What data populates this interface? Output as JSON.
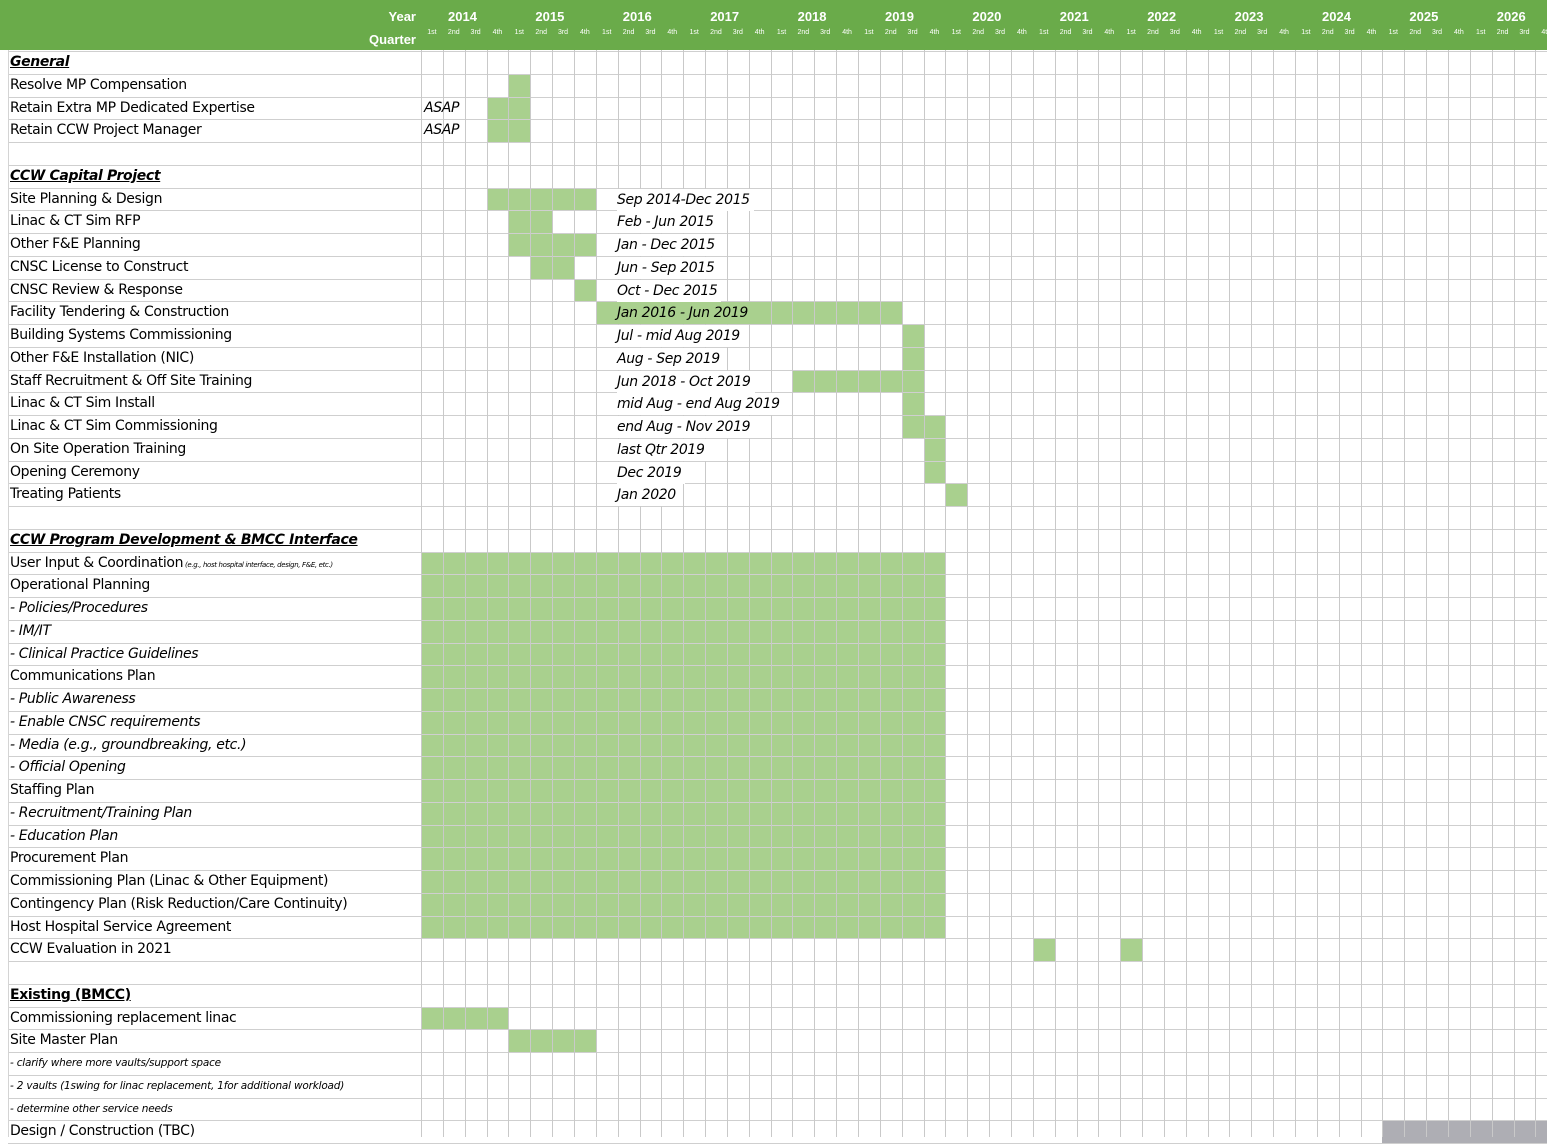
{
  "header": {
    "year_caption": "Year",
    "quarter_caption": "Quarter",
    "years": [
      "2014",
      "2015",
      "2016",
      "2017",
      "2018",
      "2019",
      "2020",
      "2021",
      "2022",
      "2023",
      "2024",
      "2025",
      "2026"
    ],
    "quarters": [
      "1st",
      "2nd",
      "3rd",
      "4th"
    ],
    "header_color": "#6aab4a"
  },
  "bar_color": "#a9d08e",
  "tbc_bar_color": "#aeaeb4",
  "sections": [
    {
      "title": "General",
      "rows": [
        {
          "label": "Resolve MP Compensation",
          "start": "2015 Q1",
          "end": "2015 Q1"
        },
        {
          "label": "Retain Extra MP Dedicated Expertise",
          "note": "ASAP",
          "start": "2014 Q4",
          "end": "2015 Q1"
        },
        {
          "label": "Retain CCW Project Manager",
          "note": "ASAP",
          "start": "2014 Q4",
          "end": "2015 Q1"
        }
      ]
    },
    {
      "title": "CCW Capital Project",
      "rows": [
        {
          "label": "Site Planning & Design",
          "dates": "Sep 2014-Dec 2015",
          "start": "2014 Q4",
          "end": "2015 Q4"
        },
        {
          "label": "Linac & CT Sim RFP",
          "dates": "Feb - Jun 2015",
          "start": "2015 Q1",
          "end": "2015 Q2"
        },
        {
          "label": "Other F&E Planning",
          "dates": "Jan - Dec 2015",
          "start": "2015 Q1",
          "end": "2015 Q4"
        },
        {
          "label": "CNSC License to Construct",
          "dates": "Jun - Sep 2015",
          "start": "2015 Q2",
          "end": "2015 Q3"
        },
        {
          "label": "CNSC Review & Response",
          "dates": "Oct - Dec 2015",
          "start": "2015 Q4",
          "end": "2015 Q4"
        },
        {
          "label": "Facility Tendering & Construction",
          "dates": "Jan 2016 - Jun 2019",
          "start": "2016 Q1",
          "end": "2019 Q2"
        },
        {
          "label": "Building Systems Commissioning",
          "dates": "Jul - mid Aug 2019",
          "start": "2019 Q3",
          "end": "2019 Q3"
        },
        {
          "label": "Other F&E Installation (NIC)",
          "dates": "Aug - Sep 2019",
          "start": "2019 Q3",
          "end": "2019 Q3"
        },
        {
          "label": "Staff Recruitment & Off Site Training",
          "dates": "Jun 2018 - Oct 2019",
          "start": "2018 Q2",
          "end": "2019 Q3"
        },
        {
          "label": "Linac & CT Sim Install",
          "dates": "mid Aug - end Aug 2019",
          "start": "2019 Q3",
          "end": "2019 Q3"
        },
        {
          "label": "Linac & CT Sim Commissioning",
          "dates": "end Aug - Nov 2019",
          "start": "2019 Q3",
          "end": "2019 Q4"
        },
        {
          "label": "On Site Operation Training",
          "dates": "last Qtr 2019",
          "start": "2019 Q4",
          "end": "2019 Q4"
        },
        {
          "label": "Opening Ceremony",
          "dates": "Dec 2019",
          "start": "2019 Q4",
          "end": "2019 Q4"
        },
        {
          "label": "Treating Patients",
          "dates": "Jan 2020",
          "start": "2020 Q1",
          "end": "2020 Q1"
        }
      ]
    },
    {
      "title": "CCW Program Development & BMCC Interface",
      "block": {
        "start": "2014 Q1",
        "end": "2019 Q4"
      },
      "rows": [
        {
          "label": "User Input & Coordination",
          "note": "(e.g., host hospital interface, design, F&E, etc.)"
        },
        {
          "label": "Operational Planning"
        },
        {
          "label": "- Policies/Procedures"
        },
        {
          "label": "- IM/IT"
        },
        {
          "label": "- Clinical Practice Guidelines"
        },
        {
          "label": "Communications Plan"
        },
        {
          "label": "- Public Awareness"
        },
        {
          "label": "- Enable CNSC requirements"
        },
        {
          "label": "- Media (e.g., groundbreaking, etc.)"
        },
        {
          "label": "- Official Opening"
        },
        {
          "label": "Staffing Plan"
        },
        {
          "label": "- Recruitment/Training Plan"
        },
        {
          "label": "- Education Plan"
        },
        {
          "label": "Procurement Plan"
        },
        {
          "label": "Commissioning Plan (Linac & Other Equipment)"
        },
        {
          "label": "Contingency Plan (Risk Reduction/Care Continuity)"
        },
        {
          "label": "Host Hospital Service Agreement"
        },
        {
          "label": "CCW Evaluation in 2021",
          "milestones": [
            "2021 Q1",
            "2022 Q1"
          ]
        }
      ]
    },
    {
      "title": "Existing (BMCC)",
      "rows": [
        {
          "label": "Commissioning replacement linac",
          "start": "2014 Q1",
          "end": "2014 Q4"
        },
        {
          "label": "Site Master Plan",
          "start": "2015 Q1",
          "end": "2015 Q4"
        },
        {
          "label": "- clarify where more vaults/support space"
        },
        {
          "label": "- 2 vaults (1swing for linac replacement, 1for additional workload)"
        },
        {
          "label": "- determine other service needs"
        },
        {
          "label": "Design / Construction (TBC)",
          "start": "2025 Q1",
          "end": "2026 Q4",
          "tbc": true
        }
      ]
    }
  ]
}
